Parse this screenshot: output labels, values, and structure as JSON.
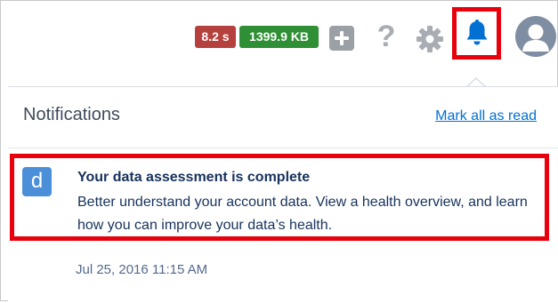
{
  "header": {
    "timing_badge": "8.2 s",
    "size_badge": "1399.9 KB",
    "help_glyph": "?",
    "icons": [
      "add-icon",
      "help-icon",
      "gear-icon",
      "bell-icon",
      "user-avatar-icon"
    ]
  },
  "notifications_panel": {
    "title": "Notifications",
    "mark_all_label": "Mark all as read",
    "items": [
      {
        "icon_letter": "d",
        "title": "Your data assessment is complete",
        "body": "Better understand your account data. View a health overview, and learn how you can improve your data’s health.",
        "timestamp": "Jul 25, 2016 11:15 AM"
      }
    ]
  },
  "colors": {
    "highlight_red": "#e8000d",
    "bell_blue": "#0070d2",
    "link_blue": "#0070d2",
    "timing_badge_red": "#b5413e",
    "size_badge_green": "#2e8f34",
    "notification_logo_blue": "#4b8fd9"
  }
}
